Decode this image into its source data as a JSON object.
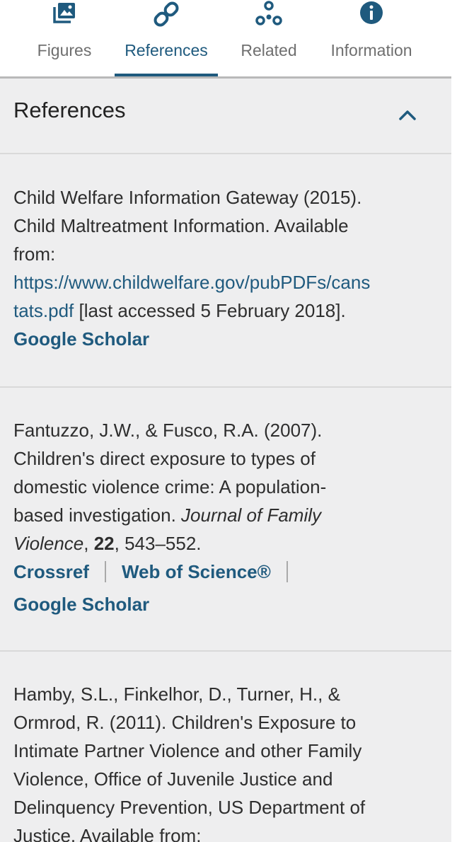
{
  "tabs": [
    {
      "label": "Figures",
      "icon": "image-icon"
    },
    {
      "label": "References",
      "icon": "link-icon"
    },
    {
      "label": "Related",
      "icon": "related-nodes-icon"
    },
    {
      "label": "Information",
      "icon": "info-icon"
    }
  ],
  "active_tab": "References",
  "colors": {
    "accent": "#1f5a7e",
    "panel_bg": "#eeeeef",
    "divider": "#d9d9d9"
  },
  "panel": {
    "title": "References",
    "collapse_icon": "chevron-up-icon"
  },
  "references": [
    {
      "line1": "Child Welfare Information Gateway (2015).",
      "line2": "Child Maltreatment Information. Available",
      "line3": "from:",
      "url_part1": "https://www.childwelfare.gov/pubPDFs/cans",
      "url_part2": "tats.pdf",
      "after_url": " [last accessed 5 February 2018].",
      "links": [
        "Google Scholar"
      ]
    },
    {
      "line1": "Fantuzzo, J.W., & Fusco, R.A. (2007).",
      "line2": "Children's direct exposure to types of",
      "line3": "domestic violence crime: A population-",
      "line4_plain": "based investigation. ",
      "journal_part1": "Journal of Family",
      "journal_part2": "Violence",
      "comma": ", ",
      "volume": "22",
      "pages": ", 543–552.",
      "links": [
        "Crossref",
        "Web of Science®",
        "Google Scholar"
      ]
    },
    {
      "line1": "Hamby, S.L., Finkelhor, D., Turner, H., &",
      "line2": "Ormrod, R. (2011). Children's Exposure to",
      "line3": "Intimate Partner Violence and other Family",
      "line4": "Violence, Office of Juvenile Justice and",
      "line5": "Delinquency Prevention, US Department of",
      "line6": "Justice. Available from:"
    }
  ]
}
